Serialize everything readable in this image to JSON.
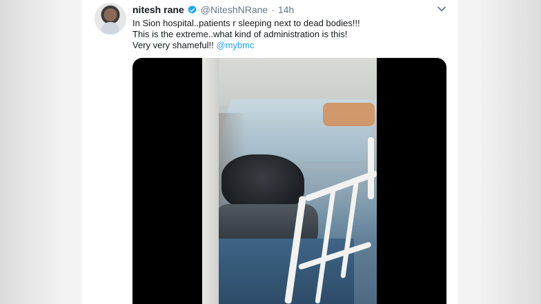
{
  "tweet": {
    "name": "nitesh rane",
    "handle": "@NiteshNRane",
    "separator": "·",
    "time": "14h",
    "lines": [
      "In Sion hospital..patients r sleeping next to dead bodies!!!",
      "This is the extreme..what kind of administration is this!",
      "Very very shameful!! "
    ],
    "mention": "@mybmc"
  },
  "colors": {
    "link": "#1da1f2",
    "verified": "#1da1f2",
    "text": "#14171a",
    "muted": "#657786"
  },
  "icons": {
    "verified": "verified-badge-icon",
    "caret": "chevron-down-icon"
  }
}
